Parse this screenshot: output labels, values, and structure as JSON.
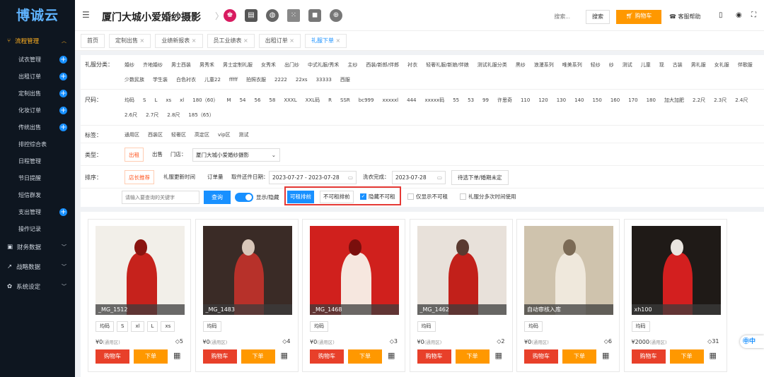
{
  "sidebar": {
    "logo": "博诚云",
    "main_group": "流程管理",
    "items": [
      {
        "label": "试衣管理",
        "plus": true
      },
      {
        "label": "出租订单",
        "plus": true
      },
      {
        "label": "定制出售",
        "plus": true
      },
      {
        "label": "化妆订单",
        "plus": true
      },
      {
        "label": "传统出售",
        "plus": true
      },
      {
        "label": "排控综合表",
        "plus": false
      },
      {
        "label": "日程管理",
        "plus": false
      },
      {
        "label": "节日提醒",
        "plus": false
      },
      {
        "label": "短信群发",
        "plus": false
      },
      {
        "label": "支出管理",
        "plus": true
      },
      {
        "label": "操作记录",
        "plus": false
      }
    ],
    "groups": [
      "财务数据",
      "战略数据",
      "系统设定"
    ]
  },
  "header": {
    "title": "厦门大城小爱婚纱摄影",
    "search_placeholder": "搜索...",
    "search_btn": "搜索",
    "cart_btn": "购物车",
    "help": "客服帮助"
  },
  "tabs": [
    "首页",
    "定制出售",
    "业绩新报表",
    "员工业绩表",
    "出租订单",
    "礼服下单"
  ],
  "filters": {
    "category_label": "礼服分类：",
    "categories": [
      "婚纱",
      "齐地婚纱",
      "男士西装",
      "男秀禾",
      "男士定制礼服",
      "女秀禾",
      "出门纱",
      "中式礼服/秀禾",
      "主纱",
      "西装/新郎/伴郎",
      "衬衣",
      "轻奢礼服/新娘/伴娘",
      "测试礼服分类",
      "黑纱",
      "浪漫系列",
      "唯美系列",
      "轻纱",
      "纱",
      "测试",
      "儿童",
      "现",
      "古装",
      "男礼服",
      "女礼服",
      "伴歌服",
      "少数民族",
      "学生装",
      "白色衬衣",
      "儿童22",
      "fffff",
      "拍照衣服",
      "2222",
      "22xs",
      "33333",
      "西服"
    ],
    "size_label": "尺码：",
    "sizes": [
      "均码",
      "S",
      "L",
      "xs",
      "xl",
      "180（60）",
      "M",
      "54",
      "56",
      "58",
      "XXXL",
      "XXL码",
      "R",
      "SSR",
      "bc999",
      "xxxxxl",
      "444",
      "xxxxx码",
      "55",
      "53",
      "99",
      "许思奇",
      "110",
      "120",
      "130",
      "140",
      "150",
      "160",
      "170",
      "180",
      "加大加肥",
      "2.2尺",
      "2.3尺",
      "2.4尺",
      "2.6尺",
      "2.7尺",
      "2.8尺",
      "185（65）"
    ],
    "tag_label": "标签：",
    "tags": [
      "通用区",
      "西装区",
      "轻奢区",
      "高定区",
      "vip区",
      "测试"
    ],
    "type_label": "类型：",
    "type_rent": "出租",
    "type_sell": "出售",
    "store_label": "门店：",
    "store_value": "厦门大城小爱婚纱摄影",
    "sort_label": "排序：",
    "sort_options": [
      "店长推荐",
      "礼服更新时间",
      "订单量"
    ],
    "pickup_label": "取件还件日期：",
    "pickup_range": "2023-07-27 - 2023-07-28",
    "wash_label": "洗衣完成：",
    "wash_date": "2023-07-28",
    "pending_btn": "待选下单/婚期未定",
    "keyword_placeholder": "请输入要查询的关键字",
    "query_btn": "查询",
    "toggle_label": "显示/隐藏",
    "rentable_first": "可租排前",
    "unrentable_first": "不可租排前",
    "hide_unrentable": "隐藏不可租",
    "only_unrentable": "仅显示不可租",
    "multi_use": "礼服分多次时间使用"
  },
  "cards": [
    {
      "name": "_MG_1512",
      "sizes": [
        "均码",
        "S",
        "xl",
        "L",
        "xs"
      ],
      "price": "¥0",
      "price_note": "(通用区)",
      "count": "5",
      "cart": "购物车",
      "order": "下单"
    },
    {
      "name": "_MG_1483",
      "sizes": [
        "均码"
      ],
      "price": "¥0",
      "price_note": "(通用区)",
      "count": "4",
      "cart": "购物车",
      "order": "下单"
    },
    {
      "name": "_MG_1468",
      "sizes": [
        "均码"
      ],
      "price": "¥0",
      "price_note": "(通用区)",
      "count": "3",
      "cart": "购物车",
      "order": "下单"
    },
    {
      "name": "_MG_1462",
      "sizes": [
        "均码"
      ],
      "price": "¥0",
      "price_note": "(通用区)",
      "count": "2",
      "cart": "购物车",
      "order": "下单"
    },
    {
      "name": "自动审核入库",
      "sizes": [
        "均码"
      ],
      "price": "¥0",
      "price_note": "(通用区)",
      "count": "6",
      "cart": "购物车",
      "order": "下单"
    },
    {
      "name": "xh100",
      "sizes": [
        "均码"
      ],
      "price": "¥2000",
      "price_note": "(通用区)",
      "count": "31",
      "cart": "购物车",
      "order": "下单"
    }
  ],
  "colors": {
    "accent": "#1890ff",
    "orange": "#ff9800",
    "red": "#e8402a",
    "sidebar": "#0e1620",
    "highlight": "#e53935"
  }
}
